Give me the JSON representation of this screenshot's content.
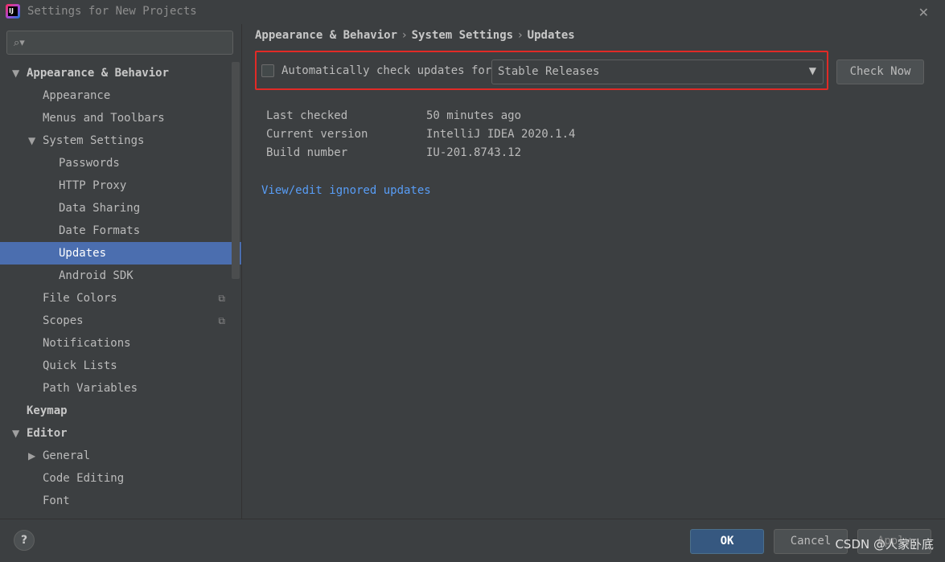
{
  "window": {
    "title": "Settings for New Projects"
  },
  "search": {
    "placeholder": ""
  },
  "sidebar": {
    "items": [
      {
        "label": "Appearance & Behavior",
        "bold": true,
        "arrow": "down"
      },
      {
        "label": "Appearance"
      },
      {
        "label": "Menus and Toolbars"
      },
      {
        "label": "System Settings",
        "arrow": "down"
      },
      {
        "label": "Passwords"
      },
      {
        "label": "HTTP Proxy"
      },
      {
        "label": "Data Sharing"
      },
      {
        "label": "Date Formats"
      },
      {
        "label": "Updates",
        "selected": true
      },
      {
        "label": "Android SDK"
      },
      {
        "label": "File Colors",
        "icon": "copy-icon"
      },
      {
        "label": "Scopes",
        "icon": "copy-icon"
      },
      {
        "label": "Notifications"
      },
      {
        "label": "Quick Lists"
      },
      {
        "label": "Path Variables"
      },
      {
        "label": "Keymap",
        "bold": true
      },
      {
        "label": "Editor",
        "bold": true,
        "arrow": "down"
      },
      {
        "label": "General",
        "arrow": "right"
      },
      {
        "label": "Code Editing"
      },
      {
        "label": "Font"
      }
    ]
  },
  "breadcrumb": {
    "items": [
      "Appearance & Behavior",
      "System Settings",
      "Updates"
    ],
    "separator": "›"
  },
  "updates": {
    "auto_check_label": "Automatically check updates for",
    "auto_check_checked": false,
    "channel": "Stable Releases",
    "check_now_label": "Check Now",
    "info": [
      {
        "label": "Last checked",
        "value": "50 minutes ago"
      },
      {
        "label": "Current version",
        "value": "IntelliJ IDEA 2020.1.4"
      },
      {
        "label": "Build number",
        "value": "IU-201.8743.12"
      }
    ],
    "ignored_link": "View/edit ignored updates"
  },
  "footer": {
    "help": "?",
    "ok": "OK",
    "cancel": "Cancel",
    "apply": "Apply"
  },
  "watermark": "CSDN @人家卧底",
  "colors": {
    "background": "#3c3f41",
    "selection": "#4b6eaf",
    "link": "#589df6",
    "highlight": "#e12a26",
    "ok_button": "#365880"
  }
}
